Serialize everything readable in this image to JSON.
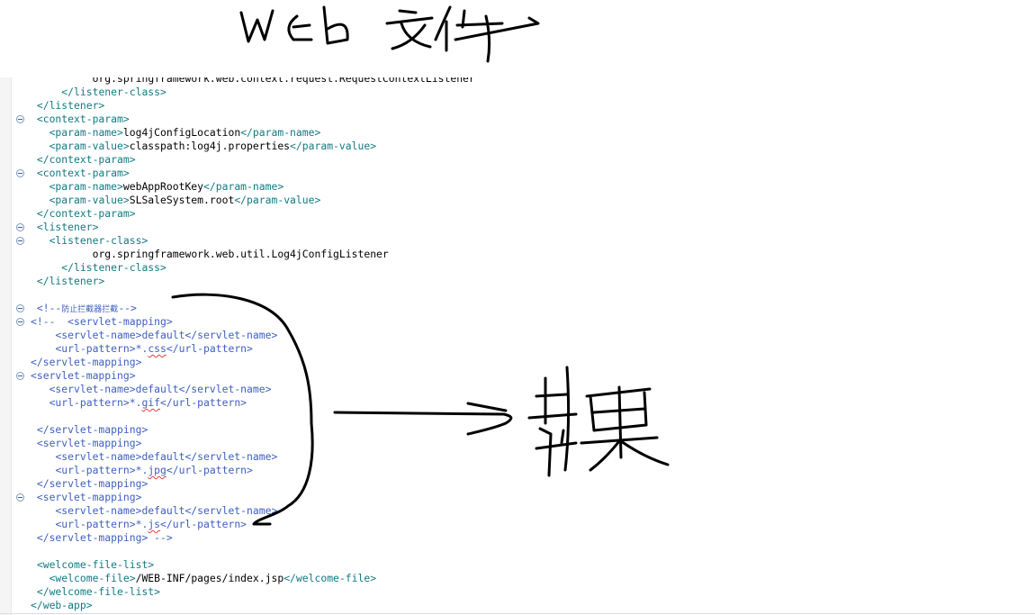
{
  "annotation": {
    "title_handwritten": "web文件",
    "result_handwritten": "结果",
    "ink_color": "#000000"
  },
  "editor": {
    "colors": {
      "tag": "#117a82",
      "text": "#000000",
      "comment": "#3f5fbf",
      "fold_icon": "#7a9ac0"
    },
    "lines": [
      {
        "fold": false,
        "indent": "          ",
        "segments": [
          {
            "t": "org.springframework.web.context.request.RequestContextListener",
            "c": "txt"
          }
        ]
      },
      {
        "fold": false,
        "indent": "     ",
        "segments": [
          {
            "t": "</listener-class>",
            "c": "tag"
          }
        ]
      },
      {
        "fold": false,
        "indent": " ",
        "segments": [
          {
            "t": "</listener>",
            "c": "tag"
          }
        ]
      },
      {
        "fold": true,
        "indent": " ",
        "segments": [
          {
            "t": "<context-param>",
            "c": "tag"
          }
        ]
      },
      {
        "fold": false,
        "indent": "   ",
        "segments": [
          {
            "t": "<param-name>",
            "c": "tag"
          },
          {
            "t": "log4jConfigLocation",
            "c": "txt"
          },
          {
            "t": "</param-name>",
            "c": "tag"
          }
        ]
      },
      {
        "fold": false,
        "indent": "   ",
        "segments": [
          {
            "t": "<param-value>",
            "c": "tag"
          },
          {
            "t": "classpath:log4j.properties",
            "c": "txt"
          },
          {
            "t": "</param-value>",
            "c": "tag"
          }
        ]
      },
      {
        "fold": false,
        "indent": " ",
        "segments": [
          {
            "t": "</context-param>",
            "c": "tag"
          }
        ]
      },
      {
        "fold": true,
        "indent": " ",
        "segments": [
          {
            "t": "<context-param>",
            "c": "tag"
          }
        ]
      },
      {
        "fold": false,
        "indent": "   ",
        "segments": [
          {
            "t": "<param-name>",
            "c": "tag"
          },
          {
            "t": "webAppRootKey",
            "c": "txt"
          },
          {
            "t": "</param-name>",
            "c": "tag"
          }
        ]
      },
      {
        "fold": false,
        "indent": "   ",
        "segments": [
          {
            "t": "<param-value>",
            "c": "tag"
          },
          {
            "t": "SLSaleSystem.root",
            "c": "txt"
          },
          {
            "t": "</param-value>",
            "c": "tag"
          }
        ]
      },
      {
        "fold": false,
        "indent": " ",
        "segments": [
          {
            "t": "</context-param>",
            "c": "tag"
          }
        ]
      },
      {
        "fold": true,
        "indent": " ",
        "segments": [
          {
            "t": "<listener>",
            "c": "tag"
          }
        ]
      },
      {
        "fold": true,
        "indent": "   ",
        "segments": [
          {
            "t": "<listener-class>",
            "c": "tag"
          }
        ]
      },
      {
        "fold": false,
        "indent": "          ",
        "segments": [
          {
            "t": "org.springframework.web.util.Log4jConfigListener",
            "c": "txt"
          }
        ]
      },
      {
        "fold": false,
        "indent": "     ",
        "segments": [
          {
            "t": "</listener-class>",
            "c": "tag"
          }
        ]
      },
      {
        "fold": false,
        "indent": " ",
        "segments": [
          {
            "t": "</listener>",
            "c": "tag"
          }
        ]
      },
      {
        "fold": false,
        "indent": "",
        "segments": []
      },
      {
        "fold": true,
        "indent": " ",
        "segments": [
          {
            "t": "<!--",
            "c": "cmt"
          },
          {
            "t": "防止拦截器拦截",
            "c": "cmt cjk"
          },
          {
            "t": "-->",
            "c": "cmt"
          }
        ]
      },
      {
        "fold": true,
        "indent": "",
        "segments": [
          {
            "t": "<!--  <servlet-mapping>",
            "c": "cmt"
          }
        ]
      },
      {
        "fold": false,
        "indent": "    ",
        "segments": [
          {
            "t": "<servlet-name>default</servlet-name>",
            "c": "cmt"
          }
        ]
      },
      {
        "fold": false,
        "indent": "    ",
        "segments": [
          {
            "t": "<url-pattern>*.",
            "c": "cmt"
          },
          {
            "t": "css",
            "c": "cmt sq"
          },
          {
            "t": "</url-pattern>",
            "c": "cmt"
          }
        ]
      },
      {
        "fold": false,
        "indent": "",
        "segments": [
          {
            "t": "</servlet-mapping>",
            "c": "cmt"
          }
        ]
      },
      {
        "fold": true,
        "indent": "",
        "segments": [
          {
            "t": "<servlet-mapping>",
            "c": "cmt"
          }
        ]
      },
      {
        "fold": false,
        "indent": "   ",
        "segments": [
          {
            "t": "<servlet-name>default</servlet-name>",
            "c": "cmt"
          }
        ]
      },
      {
        "fold": false,
        "indent": "   ",
        "segments": [
          {
            "t": "<url-pattern>*.",
            "c": "cmt"
          },
          {
            "t": "gif",
            "c": "cmt sq"
          },
          {
            "t": "</url-pattern>",
            "c": "cmt"
          }
        ]
      },
      {
        "fold": false,
        "indent": "",
        "segments": []
      },
      {
        "fold": false,
        "indent": " ",
        "segments": [
          {
            "t": "</servlet-mapping>",
            "c": "cmt"
          }
        ]
      },
      {
        "fold": false,
        "indent": " ",
        "segments": [
          {
            "t": "<servlet-mapping>",
            "c": "cmt"
          }
        ]
      },
      {
        "fold": false,
        "indent": "    ",
        "segments": [
          {
            "t": "<servlet-name>default</servlet-name>",
            "c": "cmt"
          }
        ]
      },
      {
        "fold": false,
        "indent": "    ",
        "segments": [
          {
            "t": "<url-pattern>*.",
            "c": "cmt"
          },
          {
            "t": "jpg",
            "c": "cmt sq"
          },
          {
            "t": "</url-pattern>",
            "c": "cmt"
          }
        ]
      },
      {
        "fold": false,
        "indent": " ",
        "segments": [
          {
            "t": "</servlet-mapping>",
            "c": "cmt"
          }
        ]
      },
      {
        "fold": true,
        "indent": " ",
        "segments": [
          {
            "t": "<servlet-mapping>",
            "c": "cmt"
          }
        ]
      },
      {
        "fold": false,
        "indent": "    ",
        "segments": [
          {
            "t": "<servlet-name>default</servlet-name>",
            "c": "cmt"
          }
        ]
      },
      {
        "fold": false,
        "indent": "    ",
        "segments": [
          {
            "t": "<url-pattern>*.",
            "c": "cmt"
          },
          {
            "t": "js",
            "c": "cmt sq"
          },
          {
            "t": "</url-pattern>",
            "c": "cmt"
          }
        ]
      },
      {
        "fold": false,
        "indent": " ",
        "segments": [
          {
            "t": "</servlet-mapping> -->",
            "c": "cmt"
          }
        ]
      },
      {
        "fold": false,
        "indent": "",
        "segments": []
      },
      {
        "fold": false,
        "indent": " ",
        "segments": [
          {
            "t": "<welcome-file-list>",
            "c": "tag"
          }
        ]
      },
      {
        "fold": false,
        "indent": "   ",
        "segments": [
          {
            "t": "<welcome-file>",
            "c": "tag"
          },
          {
            "t": "/WEB-INF/pages/index.jsp",
            "c": "txt"
          },
          {
            "t": "</welcome-file>",
            "c": "tag"
          }
        ]
      },
      {
        "fold": false,
        "indent": " ",
        "segments": [
          {
            "t": "</welcome-file-list>",
            "c": "tag"
          }
        ]
      },
      {
        "fold": false,
        "indent": "",
        "segments": [
          {
            "t": "</web-app>",
            "c": "tag"
          }
        ]
      }
    ]
  }
}
